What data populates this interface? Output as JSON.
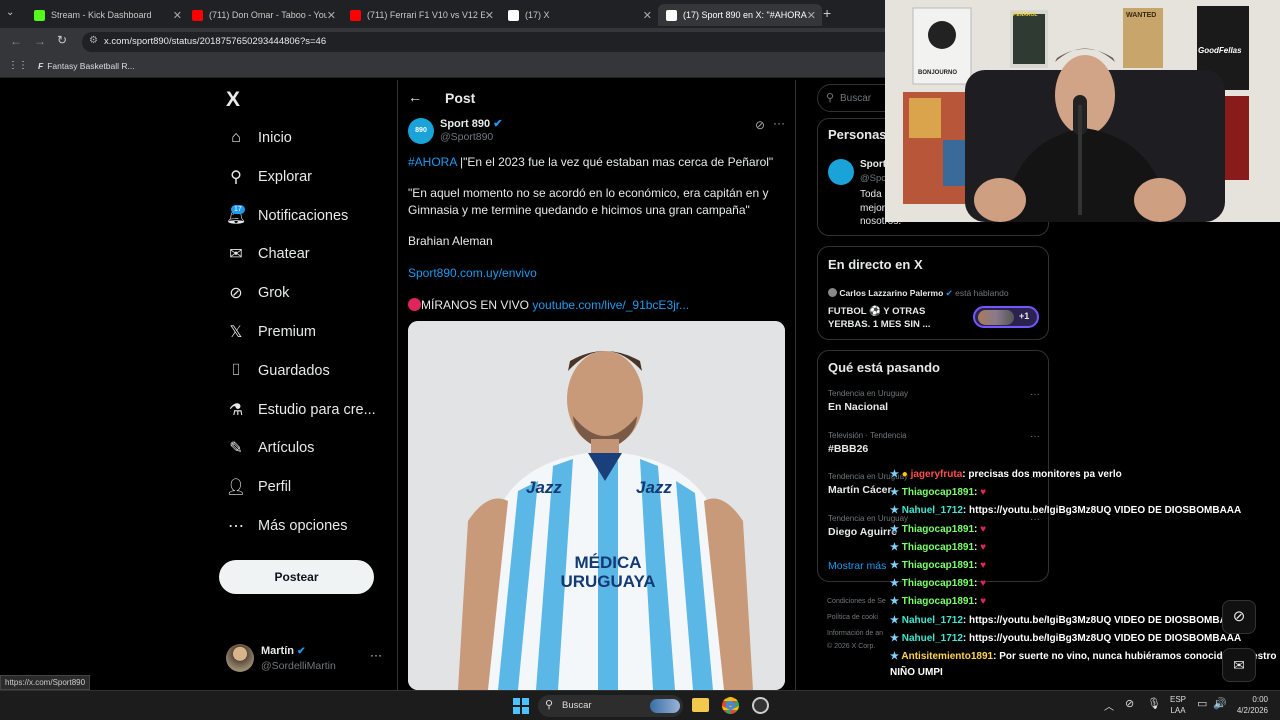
{
  "browser": {
    "tabs": [
      {
        "label": "Stream - Kick Dashboard",
        "color": "#53fc18"
      },
      {
        "label": "(711) Don Omar - Taboo - YouTu",
        "color": "#ff0000"
      },
      {
        "label": "(711) Ferrari F1 V10 vs V12 EPIC",
        "color": "#ff0000"
      },
      {
        "label": "(17) X",
        "color": "#ffffff"
      },
      {
        "label": "(17) Sport 890 en X: \"#AHORA |\"",
        "color": "#ffffff"
      }
    ],
    "url": "x.com/sport890/status/2018757650293444806?s=46",
    "bookmark": "Fantasy Basketball R...",
    "status_url": "https://x.com/Sport890"
  },
  "nav": {
    "logo": "X",
    "items": [
      {
        "label": "Inicio",
        "icon": "home-icon"
      },
      {
        "label": "Explorar",
        "icon": "search-icon"
      },
      {
        "label": "Notificaciones",
        "icon": "bell-icon"
      },
      {
        "label": "Chatear",
        "icon": "mail-icon"
      },
      {
        "label": "Grok",
        "icon": "grok-icon"
      },
      {
        "label": "Premium",
        "icon": "x-icon"
      },
      {
        "label": "Guardados",
        "icon": "bookmark-icon"
      },
      {
        "label": "Estudio para cre...",
        "icon": "flask-icon"
      },
      {
        "label": "Artículos",
        "icon": "article-icon"
      },
      {
        "label": "Perfil",
        "icon": "user-icon"
      },
      {
        "label": "Más opciones",
        "icon": "more-icon"
      }
    ],
    "notif_badge": "17",
    "post_label": "Postear",
    "account_name": "Martín",
    "account_handle": "@SordelliMartin"
  },
  "post": {
    "header": "Post",
    "author_name": "Sport 890",
    "author_handle": "@Sport890",
    "hashtag": "#AHORA",
    "line1": " |\"En el 2023 fue la vez qué estaban mas cerca de Peñarol\"",
    "para2": "\"En aquel momento no se acordó en lo económico, era capitán en y Gimnasia y me termine quedando e hicimos una gran campaña\"",
    "para3": "Brahian Aleman",
    "link1": "Sport890.com.uy/envivo",
    "live_prefix": "MÍRANOS EN VIVO ",
    "link2": "youtube.com/live/_91bcE3jr...",
    "jersey_text": "MÉDICA URUGUAYA",
    "jersey_brand": "Jazz"
  },
  "right": {
    "search_placeholder": "Buscar",
    "personas_title": "Personas",
    "person_name": "Sport",
    "person_handle": "@Spo",
    "person_bio1": "Toda",
    "person_bio2": "mejor",
    "person_bio3": "nosotros.",
    "live_title": "En directo en X",
    "live_host": "Carlos Lazzarino Palermo",
    "live_status": "está hablando",
    "live_text": "FUTBOL ⚽ Y OTRAS YERBAS. 1 MES SIN ...",
    "live_count": "+1",
    "trends_title": "Qué está pasando",
    "trends": [
      {
        "context": "Tendencia en Uruguay",
        "name": "En Nacional"
      },
      {
        "context": "Televisión · Tendencia",
        "name": "#BBB26"
      },
      {
        "context": "Tendencia en Uruguay",
        "name": "Martín Cácer"
      },
      {
        "context": "Tendencia en Uruguay",
        "name": "Diego Aguirre"
      }
    ],
    "show_more": "Mostrar más",
    "footer1": "Condiciones de Se",
    "footer2": "Política de cooki",
    "footer3": "Información de an",
    "footer4": "© 2026 X Corp."
  },
  "webcam": {
    "poster1": "BONJOURNO",
    "poster2": "WANTED",
    "poster3": "GoodFellas",
    "poster4": "PEÑAROL"
  },
  "chat": [
    {
      "user": "jageryfruta",
      "msg": ": precisas dos monitores pa verlo",
      "color": "#ff4d4d"
    },
    {
      "user": "Thiagocap1891",
      "msg": ": ",
      "color": "#7cff6b"
    },
    {
      "user": "Nahuel_1712",
      "msg": ": https://youtu.be/IgiBg3Mz8UQ VIDEO DE DIOSBOMBAAA",
      "color": "#3ee8d0"
    },
    {
      "user": "Thiagocap1891",
      "msg": ": ",
      "color": "#7cff6b"
    },
    {
      "user": "Thiagocap1891",
      "msg": ": ",
      "color": "#7cff6b"
    },
    {
      "user": "Thiagocap1891",
      "msg": ": ",
      "color": "#7cff6b"
    },
    {
      "user": "Thiagocap1891",
      "msg": ": ",
      "color": "#7cff6b"
    },
    {
      "user": "Thiagocap1891",
      "msg": ": ",
      "color": "#7cff6b"
    },
    {
      "user": "Nahuel_1712",
      "msg": ": https://youtu.be/IgiBg3Mz8UQ VIDEO DE DIOSBOMBAAA",
      "color": "#3ee8d0"
    },
    {
      "user": "Nahuel_1712",
      "msg": ": https://youtu.be/IgiBg3Mz8UQ VIDEO DE DIOSBOMBAAA",
      "color": "#3ee8d0"
    },
    {
      "user": "Antisitemiento1891",
      "msg": ": Por suerte no vino, nunca hubiéramos conocido a nuestro",
      "color": "#ffd54a"
    }
  ],
  "chat_wrap": "NIÑO UMPI",
  "taskbar": {
    "search": "Buscar",
    "lang1": "ESP",
    "lang2": "LAA",
    "time": "0:00",
    "date": "4/2/2026"
  }
}
